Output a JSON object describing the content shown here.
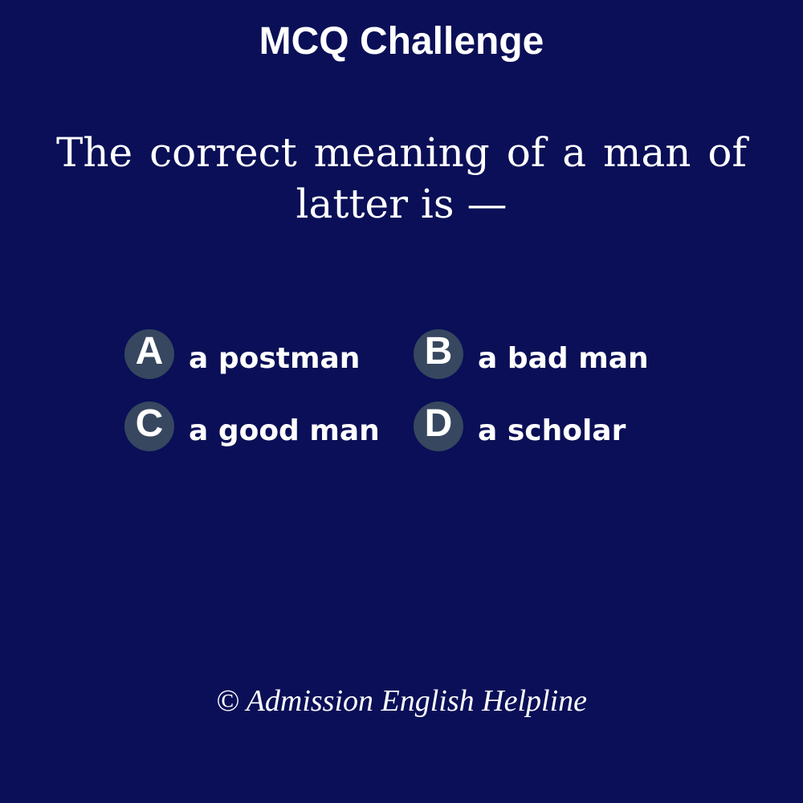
{
  "header": {
    "title": "MCQ Challenge"
  },
  "question": {
    "text": "The correct meaning of a man of latter is —"
  },
  "options": [
    {
      "letter": "A",
      "text": "a postman"
    },
    {
      "letter": "B",
      "text": "a bad man"
    },
    {
      "letter": "C",
      "text": "a good man"
    },
    {
      "letter": "D",
      "text": "a scholar"
    }
  ],
  "footer": {
    "credit": "© Admission English Helpline"
  },
  "colors": {
    "background": "#0a0f57",
    "badge": "#36475f",
    "text": "#ffffff"
  }
}
